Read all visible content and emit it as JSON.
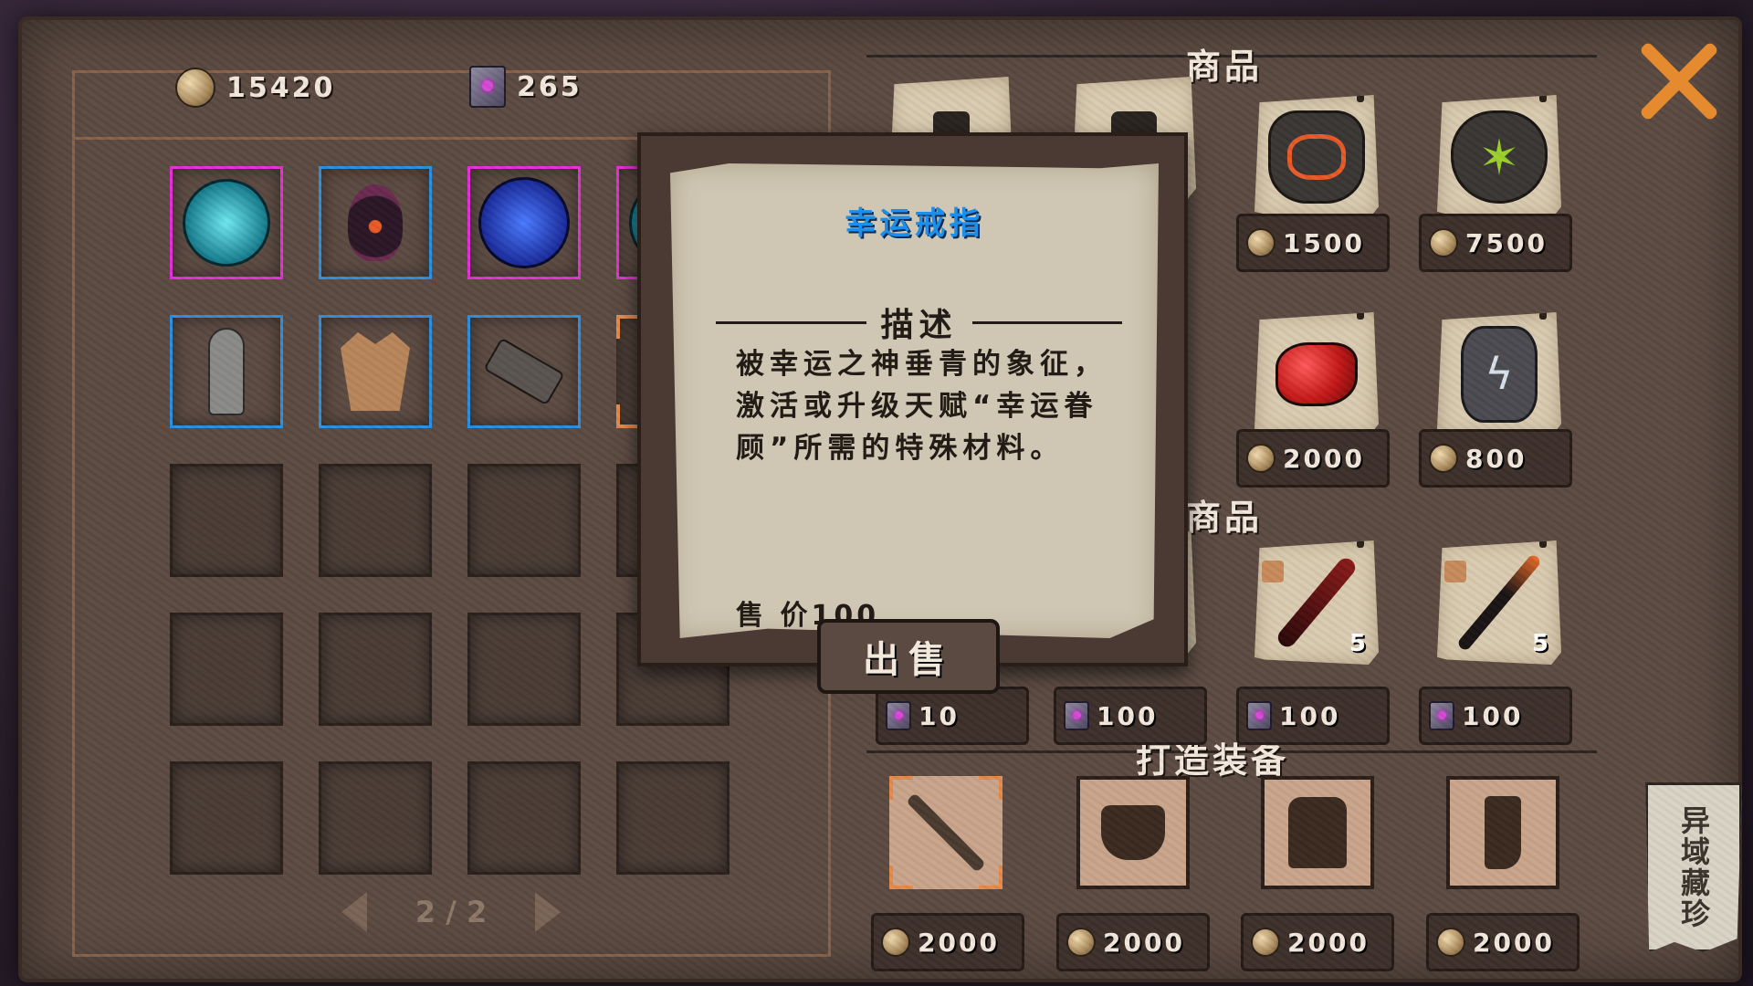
{
  "currency": {
    "gold": "15420",
    "tomes": "265"
  },
  "inventory": {
    "page": "2 / 2",
    "rows": [
      [
        {
          "icon": "cyan-eye-rune-icon",
          "frame": "pink"
        },
        {
          "icon": "dark-tentacle-eye-icon",
          "frame": "blue"
        },
        {
          "icon": "blue-chevron-rune-icon",
          "frame": "pink"
        },
        {
          "icon": "cyan-rune-icon",
          "frame": "pink"
        }
      ],
      [
        {
          "icon": "statue-icon",
          "frame": "blue"
        },
        {
          "icon": "crown-relic-icon",
          "frame": "blue"
        },
        {
          "icon": "hammer-icon",
          "frame": "blue"
        },
        {
          "icon": "ring-icon",
          "frame": "orange"
        }
      ],
      [
        {
          "icon": "",
          "frame": "empty"
        },
        {
          "icon": "",
          "frame": "empty"
        },
        {
          "icon": "",
          "frame": "empty"
        },
        {
          "icon": "",
          "frame": "empty"
        }
      ],
      [
        {
          "icon": "",
          "frame": "empty"
        },
        {
          "icon": "",
          "frame": "empty"
        },
        {
          "icon": "",
          "frame": "empty"
        },
        {
          "icon": "",
          "frame": "empty"
        }
      ],
      [
        {
          "icon": "",
          "frame": "empty"
        },
        {
          "icon": "",
          "frame": "empty"
        },
        {
          "icon": "",
          "frame": "empty"
        },
        {
          "icon": "",
          "frame": "empty"
        }
      ]
    ]
  },
  "shop": {
    "section1_title": "商品",
    "section2_title": "商品",
    "forge_title": "打造装备",
    "row1": [
      {
        "icon": "potion-bottle-icon",
        "price": ""
      },
      {
        "icon": "potion-jar-icon",
        "price": ""
      },
      {
        "icon": "beast-maw-stone-icon",
        "price": "1500"
      },
      {
        "icon": "tree-heart-stone-icon",
        "price": "7500"
      }
    ],
    "row2": [
      {
        "icon": "",
        "price": "2000"
      },
      {
        "icon": "",
        "price": "800"
      }
    ],
    "row2_icons": [
      "red-gem-icon",
      "lightning-stone-icon"
    ],
    "row3": [
      {
        "icon": "",
        "price": "10",
        "count": ""
      },
      {
        "icon": "",
        "price": "100",
        "count": ""
      },
      {
        "icon": "red-blade-icon",
        "price": "100",
        "count": "5"
      },
      {
        "icon": "dark-spear-icon",
        "price": "100",
        "count": "5"
      }
    ],
    "forge": [
      {
        "icon": "sword-icon",
        "price": "2000"
      },
      {
        "icon": "hat-icon",
        "price": "2000"
      },
      {
        "icon": "coat-icon",
        "price": "2000"
      },
      {
        "icon": "boot-icon",
        "price": "2000"
      }
    ]
  },
  "tooltip": {
    "title": "幸运戒指",
    "desc_header": "描述",
    "desc_lines": [
      "被幸运之神垂青的象征，",
      "激活或升级天赋“幸运眷",
      "顾”所需的特殊材料。"
    ],
    "sell_price": "售 价100",
    "sell_button": "出售"
  },
  "side_tab": "异域藏珍",
  "colors": {
    "accent_orange": "#e68a30",
    "rarity_blue": "#2b8fe0",
    "rarity_pink": "#e62fd8",
    "title_blue": "#1d8fe8"
  }
}
